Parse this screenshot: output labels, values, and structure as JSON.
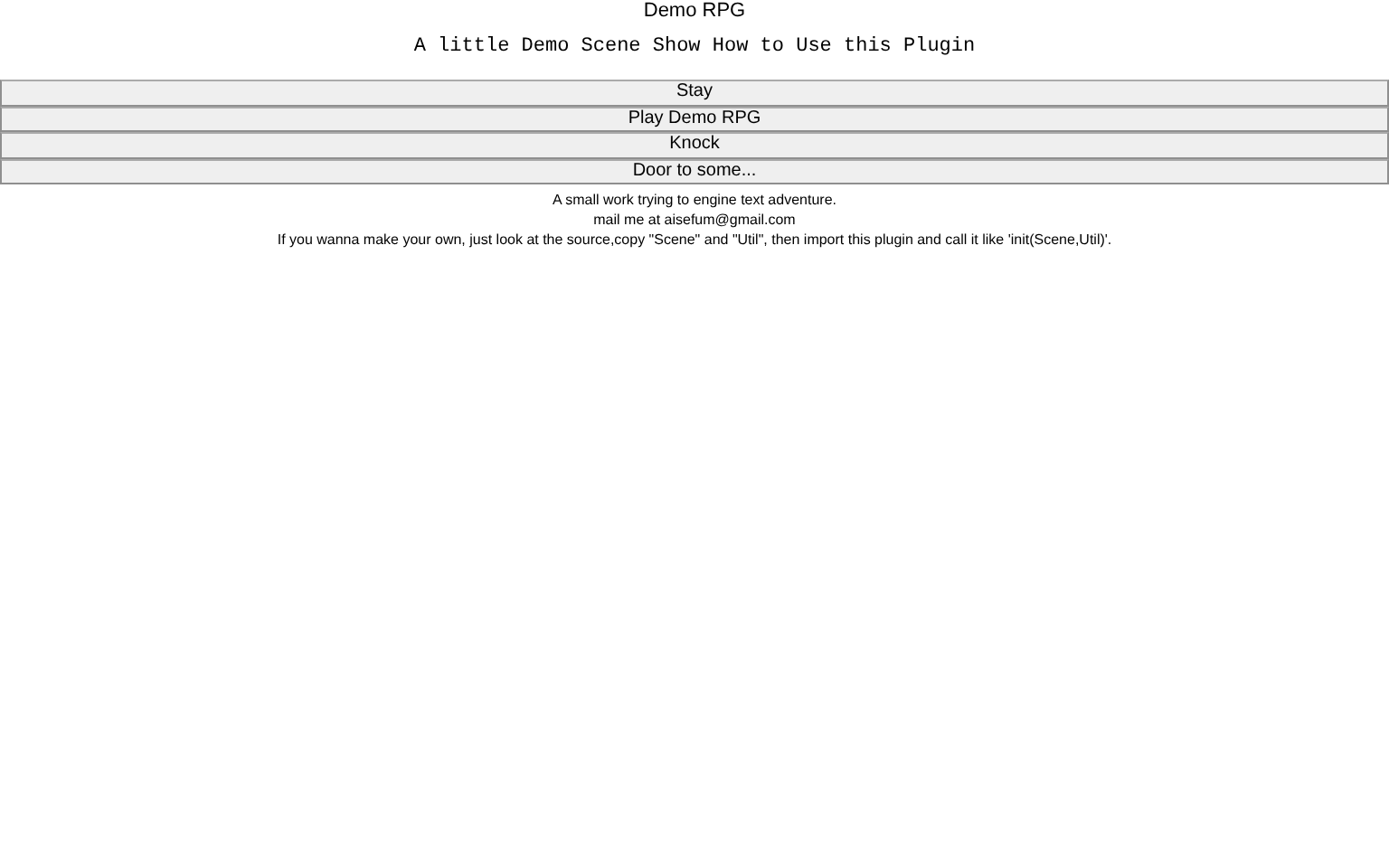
{
  "title": "Demo RPG",
  "subtitle": "A little Demo Scene Show How to Use this Plugin",
  "buttons": [
    "Stay",
    "Play Demo RPG",
    "Knock",
    "Door to some..."
  ],
  "notes": [
    "A small work trying to engine text adventure.",
    "mail me at aisefum@gmail.com",
    "If you wanna make your own, just look at the source,copy \"Scene\" and \"Util\", then import this plugin and call it like 'init(Scene,Util)'."
  ]
}
